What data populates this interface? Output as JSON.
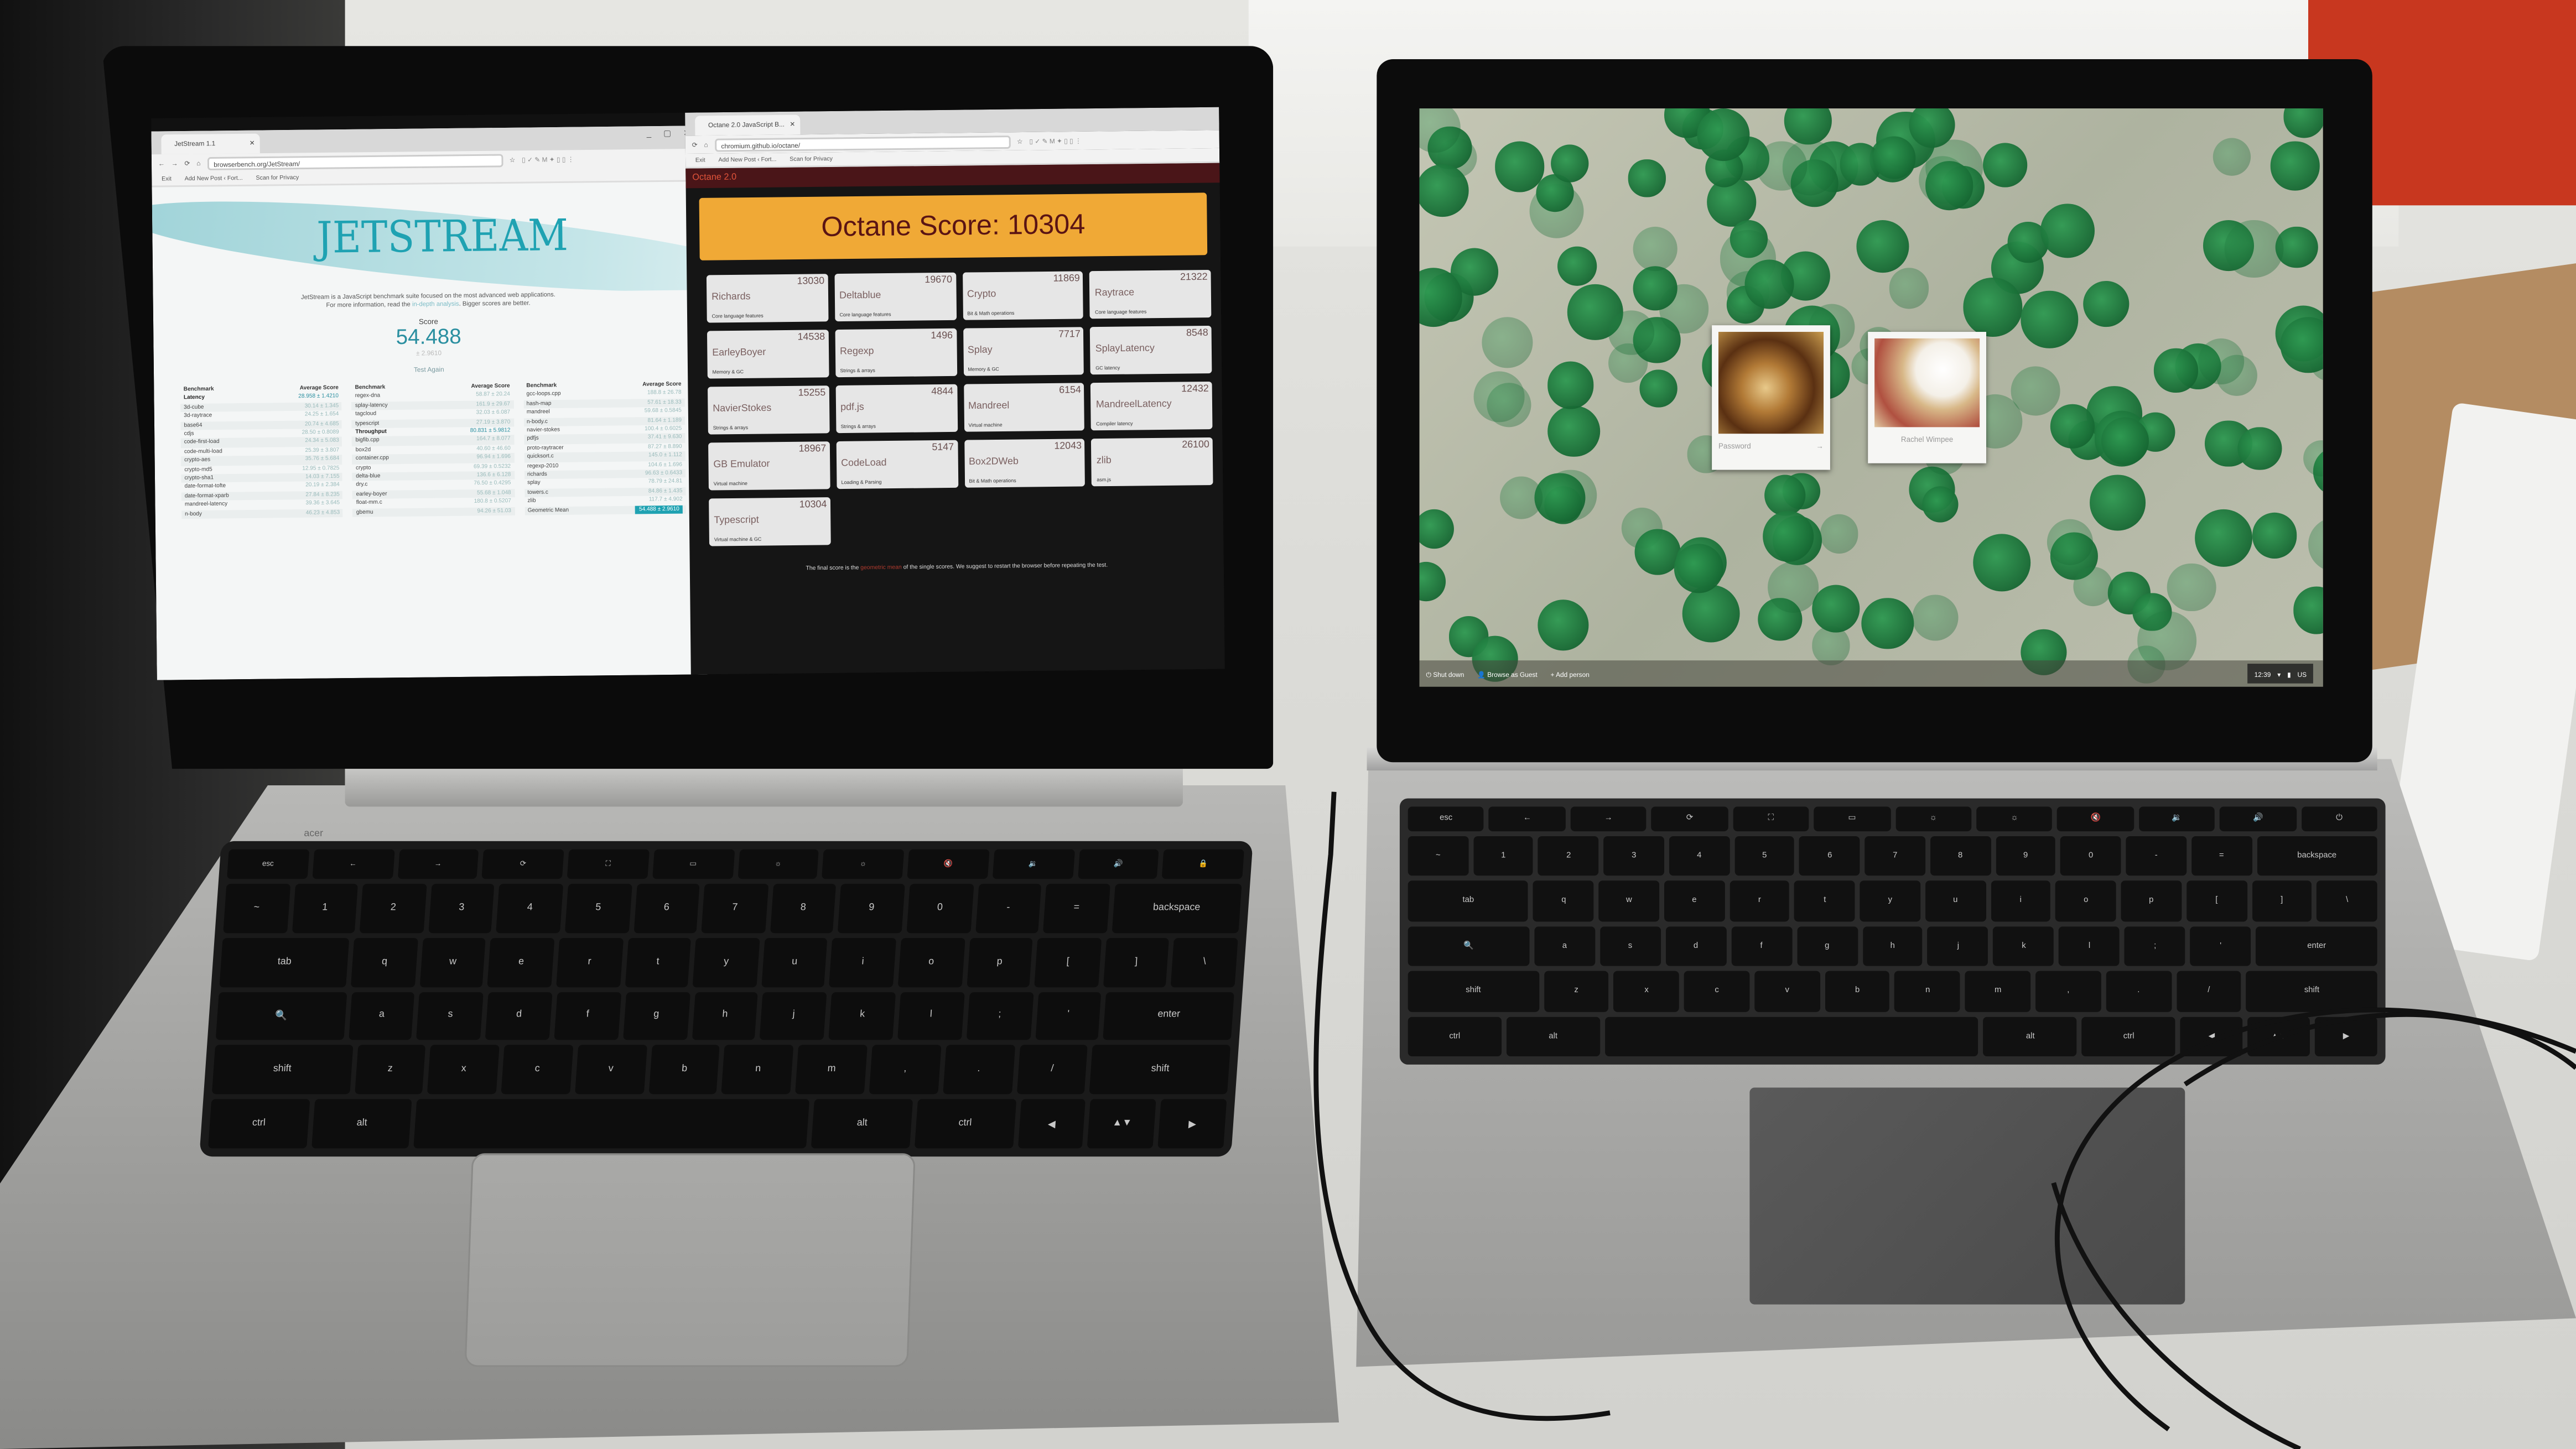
{
  "colors": {
    "jetstream_teal": "#1fa2b2",
    "octane_orange": "#f0a936",
    "octane_maroon": "#4a1518",
    "wallpaper_green": "#176a34"
  },
  "left_laptop": {
    "jetstream": {
      "tab_title": "JetStream 1.1",
      "url": "browserbench.org/JetStream/",
      "bookmarks": [
        "Exit",
        "Add New Post ‹ Fort...",
        "Scan for Privacy"
      ],
      "logo": "JETSTREAM",
      "description_1": "JetStream is a JavaScript benchmark suite focused on the most advanced web applications.",
      "description_2a": "For more information, read the ",
      "description_link": "in-depth analysis",
      "description_2b": ". Bigger scores are better.",
      "score_label": "Score",
      "score": "54.488",
      "score_pm": "± 2.9610",
      "test_again": "Test Again",
      "header_benchmark": "Benchmark",
      "header_score": "Average Score",
      "columns": [
        [
          [
            "Latency",
            "28.958 ± 1.4210"
          ],
          [
            "3d-cube",
            "30.14 ± 1.345"
          ],
          [
            "3d-raytrace",
            "24.25 ± 1.654"
          ],
          [
            "base64",
            "20.74 ± 4.685"
          ],
          [
            "cdjs",
            "28.50 ± 0.8089"
          ],
          [
            "code-first-load",
            "24.34 ± 5.083"
          ],
          [
            "code-multi-load",
            "25.39 ± 3.807"
          ],
          [
            "crypto-aes",
            "35.76 ± 5.684"
          ],
          [
            "crypto-md5",
            "12.95 ± 0.7825"
          ],
          [
            "crypto-sha1",
            "14.03 ± 7.155"
          ],
          [
            "date-format-tofte",
            "20.19 ± 2.384"
          ],
          [
            "date-format-xparb",
            "27.84 ± 8.235"
          ],
          [
            "mandreel-latency",
            "39.36 ± 3.645"
          ],
          [
            "n-body",
            "46.23 ± 4.853"
          ]
        ],
        [
          [
            "regex-dna",
            "58.87 ± 20.24"
          ],
          [
            "splay-latency",
            "161.9 ± 29.67"
          ],
          [
            "tagcloud",
            "32.03 ± 6.087"
          ],
          [
            "typescript",
            "27.19 ± 3.870"
          ],
          [
            "Throughput",
            "80.831 ± 5.9812"
          ],
          [
            "bigfib.cpp",
            "164.7 ± 8.077"
          ],
          [
            "box2d",
            "40.60 ± 46.60"
          ],
          [
            "container.cpp",
            "96.94 ± 1.696"
          ],
          [
            "crypto",
            "69.39 ± 0.5232"
          ],
          [
            "delta-blue",
            "136.6 ± 6.128"
          ],
          [
            "dry.c",
            "76.50 ± 0.4295"
          ],
          [
            "earley-boyer",
            "55.68 ± 1.048"
          ],
          [
            "float-mm.c",
            "180.8 ± 0.5207"
          ],
          [
            "gbemu",
            "94.26 ± 51.03"
          ]
        ],
        [
          [
            "gcc-loops.cpp",
            "188.8 ± 26.78"
          ],
          [
            "hash-map",
            "57.61 ± 18.33"
          ],
          [
            "mandreel",
            "59.68 ± 0.5845"
          ],
          [
            "n-body.c",
            "81.64 ± 1.189"
          ],
          [
            "navier-stokes",
            "100.4 ± 0.6025"
          ],
          [
            "pdfjs",
            "37.41 ± 9.630"
          ],
          [
            "proto-raytracer",
            "87.27 ± 8.890"
          ],
          [
            "quicksort.c",
            "145.0 ± 1.112"
          ],
          [
            "regexp-2010",
            "104.6 ± 1.696"
          ],
          [
            "richards",
            "96.63 ± 0.6433"
          ],
          [
            "splay",
            "78.79 ± 24.81"
          ],
          [
            "towers.c",
            "84.86 ± 1.435"
          ],
          [
            "zlib",
            "117.7 ± 4.902"
          ],
          [
            "Geometric Mean",
            "54.488 ± 2.9610"
          ]
        ]
      ]
    },
    "octane": {
      "tab_title": "Octane 2.0 JavaScript B...",
      "url": "chromium.github.io/octane/",
      "bookmarks": [
        "Exit",
        "Add New Post ‹ Fort...",
        "Scan for Privacy"
      ],
      "header": "Octane 2.0",
      "score_text": "Octane Score: 10304",
      "benchmarks": [
        {
          "name": "Richards",
          "score": "13030",
          "desc": "Core language features"
        },
        {
          "name": "Deltablue",
          "score": "19670",
          "desc": "Core language features"
        },
        {
          "name": "Crypto",
          "score": "11869",
          "desc": "Bit & Math operations"
        },
        {
          "name": "Raytrace",
          "score": "21322",
          "desc": "Core language features"
        },
        {
          "name": "EarleyBoyer",
          "score": "14538",
          "desc": "Memory & GC"
        },
        {
          "name": "Regexp",
          "score": "1496",
          "desc": "Strings & arrays"
        },
        {
          "name": "Splay",
          "score": "7717",
          "desc": "Memory & GC"
        },
        {
          "name": "SplayLatency",
          "score": "8548",
          "desc": "GC latency"
        },
        {
          "name": "NavierStokes",
          "score": "15255",
          "desc": "Strings & arrays"
        },
        {
          "name": "pdf.js",
          "score": "4844",
          "desc": "Strings & arrays"
        },
        {
          "name": "Mandreel",
          "score": "6154",
          "desc": "Virtual machine"
        },
        {
          "name": "MandreelLatency",
          "score": "12432",
          "desc": "Compiler latency"
        },
        {
          "name": "GB Emulator",
          "score": "18967",
          "desc": "Virtual machine"
        },
        {
          "name": "CodeLoad",
          "score": "5147",
          "desc": "Loading & Parsing"
        },
        {
          "name": "Box2DWeb",
          "score": "12043",
          "desc": "Bit & Math operations"
        },
        {
          "name": "zlib",
          "score": "26100",
          "desc": "asm.js"
        },
        {
          "name": "Typescript",
          "score": "10304",
          "desc": "Virtual machine & GC"
        }
      ],
      "footer_a": "The final score is the ",
      "footer_link": "geometric mean",
      "footer_b": " of the single scores. We suggest to restart the browser before repeating the test."
    },
    "brand": "acer",
    "keyboard": [
      [
        "esc",
        "←",
        "→",
        "⟳",
        "⛶",
        "▭",
        "☼",
        "☼",
        "🔇",
        "🔉",
        "🔊",
        "🔒"
      ],
      [
        "~",
        "1",
        "2",
        "3",
        "4",
        "5",
        "6",
        "7",
        "8",
        "9",
        "0",
        "-",
        "=",
        "backspace"
      ],
      [
        "tab",
        "q",
        "w",
        "e",
        "r",
        "t",
        "y",
        "u",
        "i",
        "o",
        "p",
        "[",
        "]",
        "\\"
      ],
      [
        "🔍",
        "a",
        "s",
        "d",
        "f",
        "g",
        "h",
        "j",
        "k",
        "l",
        ";",
        "'",
        "enter"
      ],
      [
        "shift",
        "z",
        "x",
        "c",
        "v",
        "b",
        "n",
        "m",
        ",",
        ".",
        "/",
        "shift"
      ],
      [
        "ctrl",
        "alt",
        "",
        "alt",
        "ctrl",
        "◀",
        "▲▼",
        "▶"
      ]
    ]
  },
  "right_laptop": {
    "users": [
      {
        "label": "Password",
        "arrow": "→"
      },
      {
        "label": "Rachel Wimpee"
      }
    ],
    "shelf": {
      "shutdown": "Shut down",
      "guest": "Browse as Guest",
      "add_person": "Add person"
    },
    "status": {
      "time": "12:39",
      "ime": "US"
    },
    "keyboard": [
      [
        "esc",
        "←",
        "→",
        "⟳",
        "⛶",
        "▭",
        "☼",
        "☼",
        "🔇",
        "🔉",
        "🔊",
        "⏻"
      ],
      [
        "~",
        "1",
        "2",
        "3",
        "4",
        "5",
        "6",
        "7",
        "8",
        "9",
        "0",
        "-",
        "=",
        "backspace"
      ],
      [
        "tab",
        "q",
        "w",
        "e",
        "r",
        "t",
        "y",
        "u",
        "i",
        "o",
        "p",
        "[",
        "]",
        "\\"
      ],
      [
        "🔍",
        "a",
        "s",
        "d",
        "f",
        "g",
        "h",
        "j",
        "k",
        "l",
        ";",
        "'",
        "enter"
      ],
      [
        "shift",
        "z",
        "x",
        "c",
        "v",
        "b",
        "n",
        "m",
        ",",
        ".",
        "/",
        "shift"
      ],
      [
        "ctrl",
        "alt",
        "",
        "alt",
        "ctrl",
        "◀",
        "▲▼",
        "▶"
      ]
    ]
  }
}
